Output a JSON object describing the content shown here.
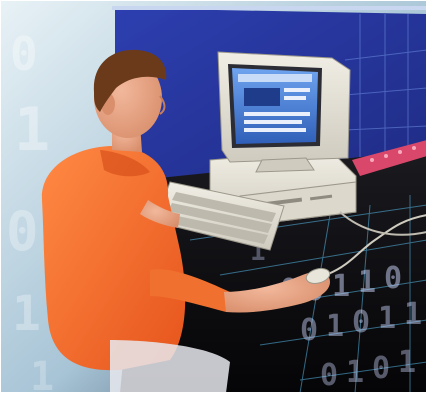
{
  "scene": {
    "subject": "person",
    "objects": [
      "crt-monitor",
      "desktop-computer",
      "keyboard",
      "mouse"
    ],
    "background_digits": [
      "0",
      "1",
      "0",
      "1",
      "1",
      "0",
      "0",
      "1",
      "1",
      "0",
      "0",
      "1",
      "0",
      "1",
      "1",
      "0",
      "1",
      "0",
      "1",
      "1"
    ],
    "colors": {
      "wall_blue": "#2f3fa8",
      "shirt_orange": "#f26a2a",
      "desk_black": "#101014",
      "computer_beige": "#e6e3d8",
      "screen_blue": "#4a7bd6",
      "grid_cyan": "#56b9e8",
      "skin": "#e8a98a",
      "hair": "#6a3a1a"
    }
  }
}
